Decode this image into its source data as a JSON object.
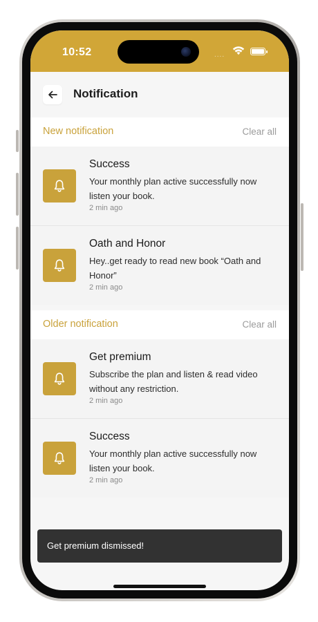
{
  "status_bar": {
    "time": "10:52",
    "signal_dots": "....",
    "wifi_icon": "wifi-icon",
    "battery_icon": "battery-icon",
    "background_color": "#d1a637"
  },
  "header": {
    "back_icon": "arrow-left-icon",
    "title": "Notification"
  },
  "sections": [
    {
      "title": "New notification",
      "clear_label": "Clear all",
      "items": [
        {
          "title": "Success",
          "body": "Your monthly plan active successfully now listen your book.",
          "time": "2 min ago",
          "icon": "bell-icon"
        },
        {
          "title": "Oath and Honor",
          "body": "Hey..get ready to read new book “Oath and Honor”",
          "time": "2 min ago",
          "icon": "bell-icon"
        }
      ]
    },
    {
      "title": "Older notification",
      "clear_label": "Clear all",
      "items": [
        {
          "title": "Get premium",
          "body": "Subscribe the plan and listen & read video without any restriction.",
          "time": "2 min ago",
          "icon": "bell-icon"
        },
        {
          "title": "Success",
          "body": "Your monthly plan active successfully now listen your book.",
          "time": "2 min ago",
          "icon": "bell-icon"
        }
      ]
    }
  ],
  "toast": {
    "message": "Get premium dismissed!"
  },
  "colors": {
    "accent": "#c9a23b",
    "toast_bg": "#323232"
  }
}
